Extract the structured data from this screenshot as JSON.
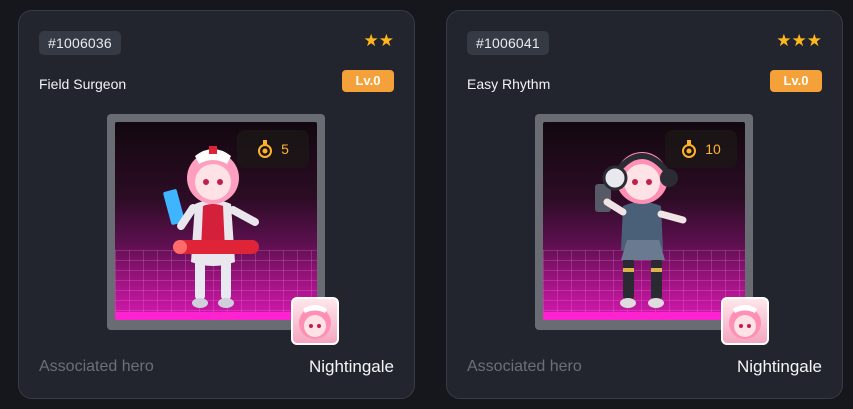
{
  "cards": [
    {
      "id": "#1006036",
      "stars": "★★",
      "star_count": 2,
      "name": "Field Surgeon",
      "level": "Lv.0",
      "favorite_count": "5",
      "associated_label": "Associated hero",
      "hero": "Nightingale"
    },
    {
      "id": "#1006041",
      "stars": "★★★",
      "star_count": 3,
      "name": "Easy Rhythm",
      "level": "Lv.0",
      "favorite_count": "10",
      "associated_label": "Associated hero",
      "hero": "Nightingale"
    }
  ],
  "colors": {
    "card_bg": "#22252e",
    "star": "#ffb81c",
    "level_badge": "#f5a13a",
    "neon_floor": "#ff22d0"
  },
  "icons": {
    "star": "star-icon",
    "favorite": "medal-icon"
  }
}
